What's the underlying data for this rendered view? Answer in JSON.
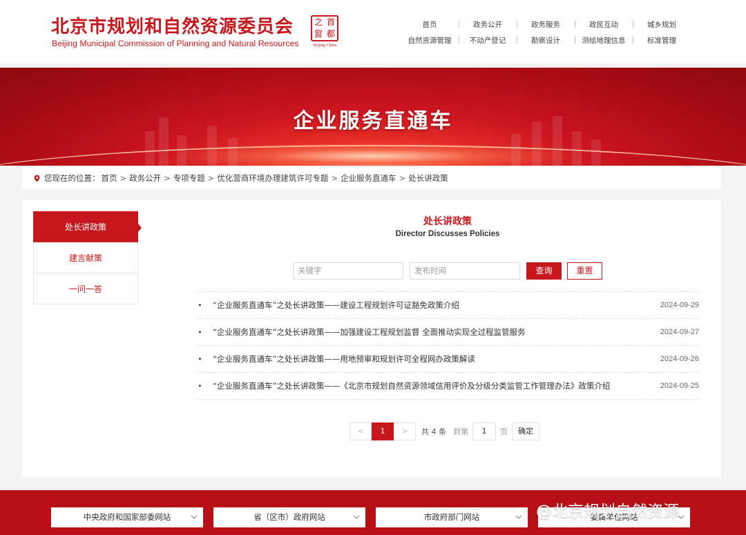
{
  "header": {
    "title_cn": "北京市规划和自然资源委员会",
    "title_en": "Beijing Municipal Commission of Planning and Natural Resources",
    "seal_chars": [
      "首",
      "都",
      "之",
      "窗"
    ],
    "seal_sub": "Beijing·China"
  },
  "nav": {
    "row1": [
      "首页",
      "政务公开",
      "政务服务",
      "政民互动",
      "城乡规划"
    ],
    "row2": [
      "自然资源管理",
      "不动产登记",
      "勘察设计",
      "测绘地理信息",
      "标准管理"
    ]
  },
  "banner": {
    "title": "企业服务直通车"
  },
  "breadcrumb": {
    "prefix": "您现在的位置：",
    "items": [
      "首页",
      "政务公开",
      "专项专题",
      "优化营商环境办理建筑许可专题",
      "企业服务直通车",
      "处长讲政策"
    ],
    "separator": ">"
  },
  "sidebar": {
    "items": [
      "处长讲政策",
      "建言献策",
      "一问一答"
    ],
    "active_index": 0
  },
  "section": {
    "title": "处长讲政策",
    "subtitle": "Director Discusses Policies"
  },
  "search": {
    "keyword_placeholder": "关键字",
    "date_placeholder": "发布时间",
    "query_label": "查询",
    "reset_label": "重置"
  },
  "articles": [
    {
      "title": "“企业服务直通车”之处长讲政策——建设工程规划许可证豁免政策介绍",
      "date": "2024-09-29"
    },
    {
      "title": "“企业服务直通车”之处长讲政策——加强建设工程规划监督 全面推动实现全过程监管服务",
      "date": "2024-09-27"
    },
    {
      "title": "“企业服务直通车”之处长讲政策——用地预审和规划许可全程网办政策解读",
      "date": "2024-09-26"
    },
    {
      "title": "“企业服务直通车”之处长讲政策——《北京市规划自然资源领域信用评价及分级分类监管工作管理办法》政策介绍",
      "date": "2024-09-25"
    }
  ],
  "pagination": {
    "prev": "<",
    "current": "1",
    "next": ">",
    "total_text": "共 4 条",
    "goto_label": "到第",
    "goto_value": "1",
    "page_unit": "页",
    "confirm_label": "确定"
  },
  "footer": {
    "selects": [
      "中央政府和国家部委网站",
      "省（区市）政府网站",
      "市政府部门网站",
      "委属单位网站"
    ]
  },
  "watermark": "@北京规划自然资源",
  "colors": {
    "brand_red": "#c8161d",
    "footer_red": "#b80f16"
  }
}
